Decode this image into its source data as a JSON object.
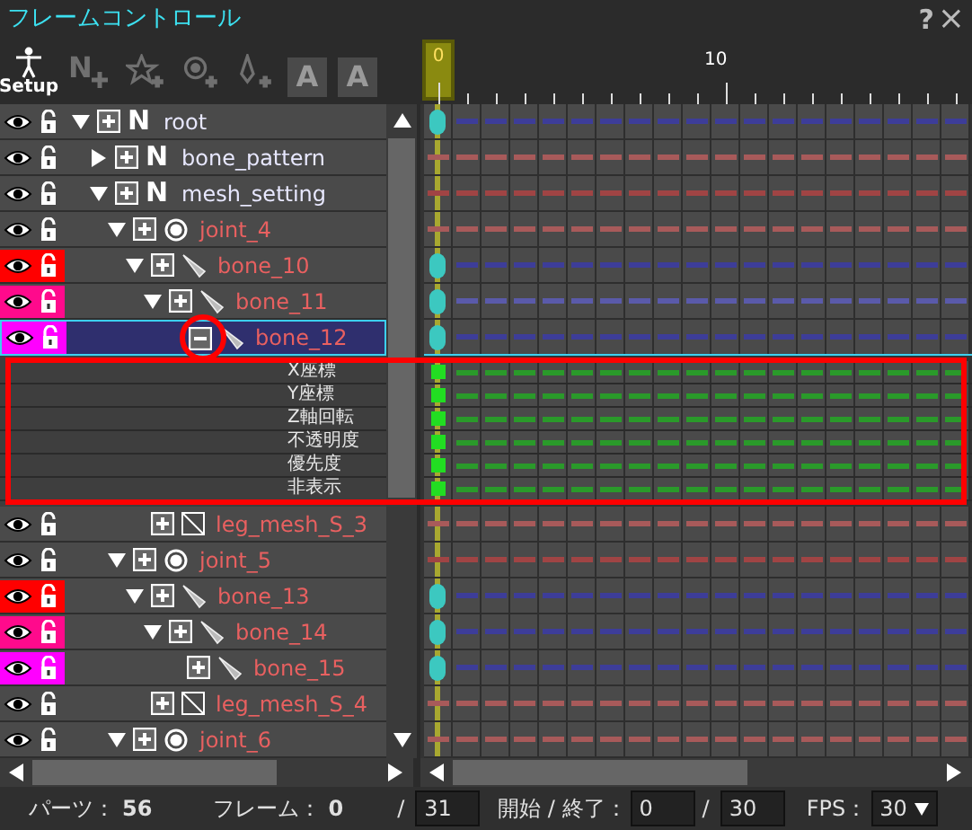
{
  "window": {
    "title": "フレームコントロール",
    "help": "?",
    "close": "×"
  },
  "toolbar": [
    {
      "kind": "setup",
      "label": "Setup",
      "disabled": false
    },
    {
      "kind": "add-null",
      "glyph": "N",
      "disabled": true
    },
    {
      "kind": "add-star",
      "disabled": true
    },
    {
      "kind": "add-joint",
      "disabled": true
    },
    {
      "kind": "add-bone",
      "disabled": true
    },
    {
      "kind": "undo-text",
      "glyph": "A",
      "disabled": true
    },
    {
      "kind": "redo-text",
      "glyph": "A",
      "disabled": true
    }
  ],
  "timeline": {
    "labels": [
      {
        "text": "0",
        "selected": true
      },
      {
        "text": "10",
        "selected": false
      }
    ]
  },
  "tree": [
    {
      "name": "root",
      "kind": "null",
      "glyph": "N",
      "expanded": true,
      "selected": false,
      "properties_open": false,
      "track": {
        "color": "#3d3d99",
        "keyframe": true
      },
      "children": [
        {
          "name": "bone_pattern",
          "kind": "null",
          "glyph": "N",
          "expanded": false,
          "selected": false,
          "properties_open": false,
          "track": {
            "color": "#a85a5a",
            "keyframe": false
          }
        },
        {
          "name": "mesh_setting",
          "kind": "null",
          "glyph": "N",
          "expanded": true,
          "selected": false,
          "properties_open": false,
          "track": {
            "color": "#a04444",
            "keyframe": false
          },
          "children": [
            {
              "name": "joint_4",
              "kind": "joint",
              "expanded": true,
              "selected": false,
              "properties_open": false,
              "track": {
                "color": "#a85a5a",
                "keyframe": false
              },
              "children": [
                {
                  "name": "bone_10",
                  "kind": "bone",
                  "highlight": {
                    "color": "#ff0000"
                  },
                  "expanded": true,
                  "selected": false,
                  "properties_open": false,
                  "track": {
                    "color": "#3d3d99",
                    "keyframe": true
                  },
                  "children": [
                    {
                      "name": "bone_11",
                      "kind": "bone",
                      "highlight": {
                        "color": "#ff0a8c"
                      },
                      "expanded": true,
                      "selected": false,
                      "properties_open": false,
                      "track": {
                        "color": "#5a5aaa",
                        "keyframe": true
                      },
                      "children": [
                        {
                          "name": "bone_12",
                          "kind": "bone",
                          "highlight": {
                            "color": "#ff00ff"
                          },
                          "selected": true,
                          "properties_open": true,
                          "track": {
                            "color": "#3d3d99",
                            "keyframe": true
                          },
                          "properties": [
                            {
                              "label": "X座標",
                              "keyframe": true
                            },
                            {
                              "label": "Y座標",
                              "keyframe": true
                            },
                            {
                              "label": "Z軸回転",
                              "keyframe": true
                            },
                            {
                              "label": "不透明度",
                              "keyframe": true
                            },
                            {
                              "label": "優先度",
                              "keyframe": true
                            },
                            {
                              "label": "非表示",
                              "keyframe": true
                            }
                          ]
                        }
                      ]
                    }
                  ]
                },
                {
                  "name": "leg_mesh_S_3",
                  "kind": "mesh",
                  "selected": false,
                  "properties_open": false,
                  "track": {
                    "color": "#a85a5a",
                    "keyframe": false
                  }
                }
              ]
            },
            {
              "name": "joint_5",
              "kind": "joint",
              "expanded": true,
              "selected": false,
              "properties_open": false,
              "track": {
                "color": "#a04444",
                "keyframe": false
              },
              "children": [
                {
                  "name": "bone_13",
                  "kind": "bone",
                  "highlight": {
                    "color": "#ff0000"
                  },
                  "expanded": true,
                  "selected": false,
                  "properties_open": false,
                  "track": {
                    "color": "#3d3d99",
                    "keyframe": true
                  },
                  "children": [
                    {
                      "name": "bone_14",
                      "kind": "bone",
                      "highlight": {
                        "color": "#ff0a8c"
                      },
                      "expanded": true,
                      "selected": false,
                      "properties_open": false,
                      "track": {
                        "color": "#3d3d99",
                        "keyframe": true
                      },
                      "children": [
                        {
                          "name": "bone_15",
                          "kind": "bone",
                          "highlight": {
                            "color": "#ff00ff"
                          },
                          "selected": false,
                          "properties_open": false,
                          "track": {
                            "color": "#3d3d99",
                            "keyframe": true
                          }
                        }
                      ]
                    }
                  ]
                },
                {
                  "name": "leg_mesh_S_4",
                  "kind": "mesh",
                  "selected": false,
                  "properties_open": false,
                  "track": {
                    "color": "#a85a5a",
                    "keyframe": false
                  }
                }
              ]
            },
            {
              "name": "joint_6",
              "kind": "joint",
              "expanded": true,
              "selected": false,
              "properties_open": false,
              "track": {
                "color": "#a85a5a",
                "keyframe": false
              }
            }
          ]
        }
      ]
    }
  ],
  "annotations": [
    {
      "kind": "circle"
    },
    {
      "kind": "rectangle"
    }
  ],
  "footer": {
    "parts_label": "パーツ：",
    "parts": "56",
    "frame_label": "フレーム：",
    "frame": "0",
    "separator": "/",
    "total": "31",
    "range_label": "開始 / 終了：",
    "start": "0",
    "range_separator": "/",
    "end": "30",
    "fps_label": "FPS：",
    "fps": "30"
  }
}
